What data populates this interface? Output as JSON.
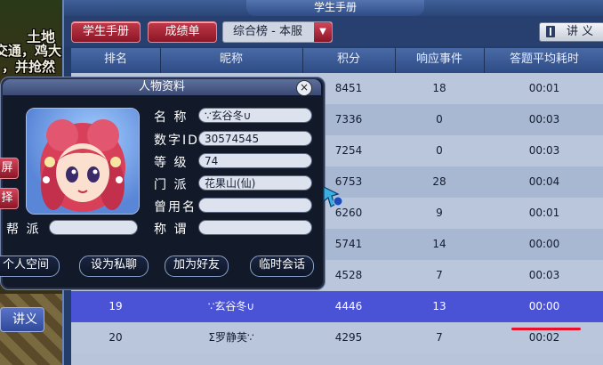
{
  "scene": {
    "text_line1": "土地",
    "text_line2": "交通，鸡大",
    "text_line3": "，并抢然"
  },
  "window": {
    "title": "学生手册"
  },
  "toolbar": {
    "student_handbook": "学生手册",
    "grades": "成绩单",
    "ranking_select": "综合榜 - 本服",
    "lecture": "讲 义"
  },
  "table": {
    "headers": [
      "排名",
      "昵称",
      "积分",
      "响应事件",
      "答题平均耗时"
    ],
    "rows": [
      {
        "rank": "",
        "name": "",
        "score": "8451",
        "events": "18",
        "time": "00:01"
      },
      {
        "rank": "",
        "name": "",
        "score": "7336",
        "events": "0",
        "time": "00:03"
      },
      {
        "rank": "",
        "name": "",
        "score": "7254",
        "events": "0",
        "time": "00:03"
      },
      {
        "rank": "",
        "name": "",
        "score": "6753",
        "events": "28",
        "time": "00:04"
      },
      {
        "rank": "",
        "name": "",
        "score": "6260",
        "events": "9",
        "time": "00:01"
      },
      {
        "rank": "",
        "name": "",
        "score": "5741",
        "events": "14",
        "time": "00:00"
      },
      {
        "rank": "",
        "name": "",
        "score": "4528",
        "events": "7",
        "time": "00:03"
      },
      {
        "rank": "19",
        "name": "∵玄谷冬∪",
        "score": "4446",
        "events": "13",
        "time": "00:00"
      },
      {
        "rank": "20",
        "name": "Σ罗静芙∵",
        "score": "4295",
        "events": "7",
        "time": "00:02"
      }
    ],
    "selected_row": 7
  },
  "side_button": {
    "label": "讲义"
  },
  "profile": {
    "title": "人物资料",
    "name_label": "名  称",
    "name_value": "∵玄谷冬∪",
    "id_label": "数字ID",
    "id_value": "30574545",
    "level_label": "等  级",
    "level_value": "74",
    "school_label": "门  派",
    "school_value": "花果山(仙)",
    "former_label": "曾用名",
    "former_value": "",
    "title_label": "称  谓",
    "title_value": "",
    "gang_label": "帮  派",
    "gang_value": "",
    "edge_btn1": "屏",
    "edge_btn2": "择",
    "actions": {
      "space": "个人空间",
      "private_chat": "设为私聊",
      "add_friend": "加为好友",
      "temp_chat": "临时会话"
    }
  },
  "colors": {
    "selected_row": "#4a52d6",
    "red_button": "#a82234",
    "red_underline": "#e8102a"
  }
}
